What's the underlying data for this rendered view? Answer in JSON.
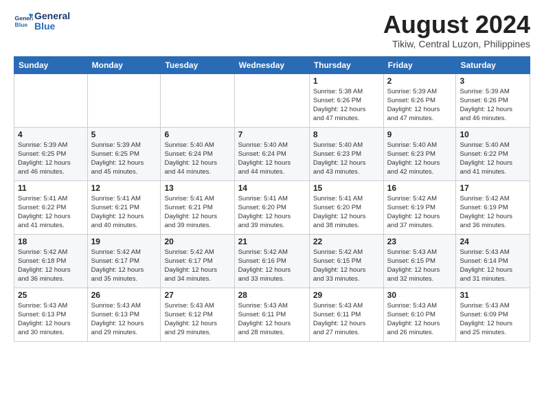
{
  "logo": {
    "line1": "General",
    "line2": "Blue"
  },
  "title": {
    "month_year": "August 2024",
    "location": "Tikiw, Central Luzon, Philippines"
  },
  "headers": [
    "Sunday",
    "Monday",
    "Tuesday",
    "Wednesday",
    "Thursday",
    "Friday",
    "Saturday"
  ],
  "weeks": [
    [
      {
        "day": "",
        "info": ""
      },
      {
        "day": "",
        "info": ""
      },
      {
        "day": "",
        "info": ""
      },
      {
        "day": "",
        "info": ""
      },
      {
        "day": "1",
        "info": "Sunrise: 5:38 AM\nSunset: 6:26 PM\nDaylight: 12 hours\nand 47 minutes."
      },
      {
        "day": "2",
        "info": "Sunrise: 5:39 AM\nSunset: 6:26 PM\nDaylight: 12 hours\nand 47 minutes."
      },
      {
        "day": "3",
        "info": "Sunrise: 5:39 AM\nSunset: 6:26 PM\nDaylight: 12 hours\nand 46 minutes."
      }
    ],
    [
      {
        "day": "4",
        "info": "Sunrise: 5:39 AM\nSunset: 6:25 PM\nDaylight: 12 hours\nand 46 minutes."
      },
      {
        "day": "5",
        "info": "Sunrise: 5:39 AM\nSunset: 6:25 PM\nDaylight: 12 hours\nand 45 minutes."
      },
      {
        "day": "6",
        "info": "Sunrise: 5:40 AM\nSunset: 6:24 PM\nDaylight: 12 hours\nand 44 minutes."
      },
      {
        "day": "7",
        "info": "Sunrise: 5:40 AM\nSunset: 6:24 PM\nDaylight: 12 hours\nand 44 minutes."
      },
      {
        "day": "8",
        "info": "Sunrise: 5:40 AM\nSunset: 6:23 PM\nDaylight: 12 hours\nand 43 minutes."
      },
      {
        "day": "9",
        "info": "Sunrise: 5:40 AM\nSunset: 6:23 PM\nDaylight: 12 hours\nand 42 minutes."
      },
      {
        "day": "10",
        "info": "Sunrise: 5:40 AM\nSunset: 6:22 PM\nDaylight: 12 hours\nand 41 minutes."
      }
    ],
    [
      {
        "day": "11",
        "info": "Sunrise: 5:41 AM\nSunset: 6:22 PM\nDaylight: 12 hours\nand 41 minutes."
      },
      {
        "day": "12",
        "info": "Sunrise: 5:41 AM\nSunset: 6:21 PM\nDaylight: 12 hours\nand 40 minutes."
      },
      {
        "day": "13",
        "info": "Sunrise: 5:41 AM\nSunset: 6:21 PM\nDaylight: 12 hours\nand 39 minutes."
      },
      {
        "day": "14",
        "info": "Sunrise: 5:41 AM\nSunset: 6:20 PM\nDaylight: 12 hours\nand 39 minutes."
      },
      {
        "day": "15",
        "info": "Sunrise: 5:41 AM\nSunset: 6:20 PM\nDaylight: 12 hours\nand 38 minutes."
      },
      {
        "day": "16",
        "info": "Sunrise: 5:42 AM\nSunset: 6:19 PM\nDaylight: 12 hours\nand 37 minutes."
      },
      {
        "day": "17",
        "info": "Sunrise: 5:42 AM\nSunset: 6:19 PM\nDaylight: 12 hours\nand 36 minutes."
      }
    ],
    [
      {
        "day": "18",
        "info": "Sunrise: 5:42 AM\nSunset: 6:18 PM\nDaylight: 12 hours\nand 36 minutes."
      },
      {
        "day": "19",
        "info": "Sunrise: 5:42 AM\nSunset: 6:17 PM\nDaylight: 12 hours\nand 35 minutes."
      },
      {
        "day": "20",
        "info": "Sunrise: 5:42 AM\nSunset: 6:17 PM\nDaylight: 12 hours\nand 34 minutes."
      },
      {
        "day": "21",
        "info": "Sunrise: 5:42 AM\nSunset: 6:16 PM\nDaylight: 12 hours\nand 33 minutes."
      },
      {
        "day": "22",
        "info": "Sunrise: 5:42 AM\nSunset: 6:15 PM\nDaylight: 12 hours\nand 33 minutes."
      },
      {
        "day": "23",
        "info": "Sunrise: 5:43 AM\nSunset: 6:15 PM\nDaylight: 12 hours\nand 32 minutes."
      },
      {
        "day": "24",
        "info": "Sunrise: 5:43 AM\nSunset: 6:14 PM\nDaylight: 12 hours\nand 31 minutes."
      }
    ],
    [
      {
        "day": "25",
        "info": "Sunrise: 5:43 AM\nSunset: 6:13 PM\nDaylight: 12 hours\nand 30 minutes."
      },
      {
        "day": "26",
        "info": "Sunrise: 5:43 AM\nSunset: 6:13 PM\nDaylight: 12 hours\nand 29 minutes."
      },
      {
        "day": "27",
        "info": "Sunrise: 5:43 AM\nSunset: 6:12 PM\nDaylight: 12 hours\nand 29 minutes."
      },
      {
        "day": "28",
        "info": "Sunrise: 5:43 AM\nSunset: 6:11 PM\nDaylight: 12 hours\nand 28 minutes."
      },
      {
        "day": "29",
        "info": "Sunrise: 5:43 AM\nSunset: 6:11 PM\nDaylight: 12 hours\nand 27 minutes."
      },
      {
        "day": "30",
        "info": "Sunrise: 5:43 AM\nSunset: 6:10 PM\nDaylight: 12 hours\nand 26 minutes."
      },
      {
        "day": "31",
        "info": "Sunrise: 5:43 AM\nSunset: 6:09 PM\nDaylight: 12 hours\nand 25 minutes."
      }
    ]
  ]
}
